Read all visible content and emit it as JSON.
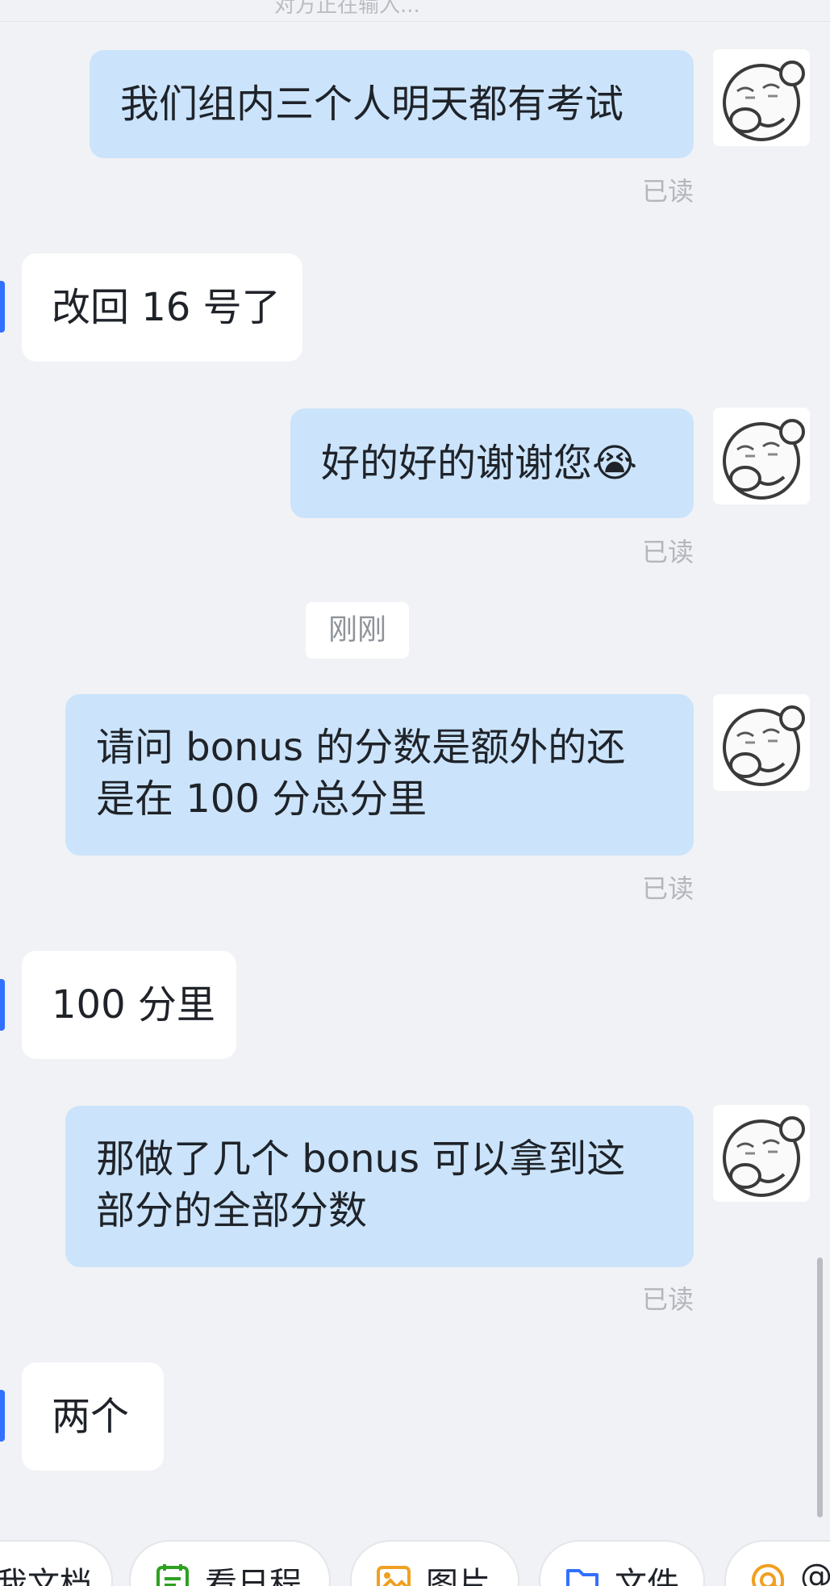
{
  "header": {
    "typing_status": "对方正在输入..."
  },
  "messages": [
    {
      "direction": "out",
      "text": "我们组内三个人明天都有考试",
      "read": "已读"
    },
    {
      "direction": "in",
      "text": "改回 16 号了"
    },
    {
      "direction": "out",
      "text": "好的好的谢谢您😭",
      "read": "已读"
    },
    {
      "direction": "out",
      "text_line1": "请问 bonus 的分数是额外的还",
      "text_line2": "是在 100 分总分里",
      "read": "已读"
    },
    {
      "direction": "in",
      "text": "100 分里"
    },
    {
      "direction": "out",
      "text_line1": "那做了几个 bonus 可以拿到这",
      "text_line2": "部分的全部分数",
      "read": "已读"
    },
    {
      "direction": "in",
      "text": "两个"
    }
  ],
  "timestamp_divider": "刚刚",
  "toolbar": {
    "items": [
      {
        "label": "我文档",
        "icon": "doc-icon"
      },
      {
        "label": "看日程",
        "icon": "calendar-icon",
        "color": "#2ea121"
      },
      {
        "label": "图片",
        "icon": "image-icon",
        "color": "#f0a020"
      },
      {
        "label": "文件",
        "icon": "folder-icon",
        "color": "#3370ff"
      },
      {
        "label": "@",
        "icon": "at-icon",
        "color": "#f0a020"
      }
    ]
  },
  "colors": {
    "outgoing_bubble": "#cbe4fb",
    "incoming_bubble": "#ffffff",
    "background": "#f1f2f5",
    "accent": "#3370ff"
  }
}
